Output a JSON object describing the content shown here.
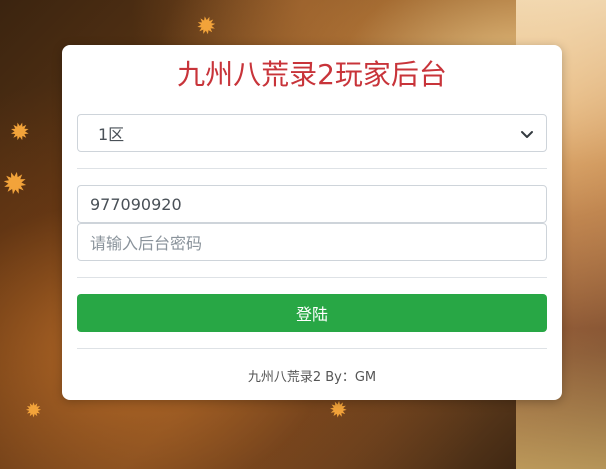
{
  "header": {
    "title": "九州八荒录2玩家后台"
  },
  "form": {
    "server_select": {
      "selected_value": "1区"
    },
    "account_input": {
      "value": "977090920"
    },
    "password_input": {
      "placeholder": "请输入后台密码"
    },
    "login_button_label": "登陆"
  },
  "footer": {
    "credit": "九州八荒录2 By：GM"
  },
  "colors": {
    "title": "#c8343a",
    "login_button": "#28a745",
    "card_background": "#ffffff"
  },
  "icons": {
    "select_arrow": "chevron-down-icon",
    "decorations": "maple-leaf-icon"
  }
}
